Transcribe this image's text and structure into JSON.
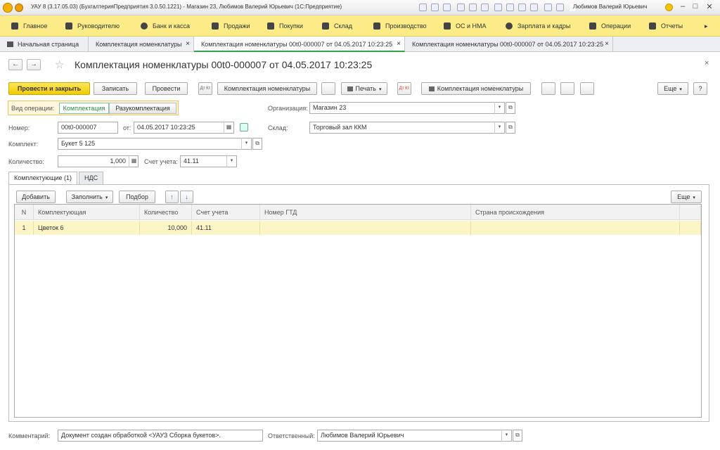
{
  "window": {
    "title": "УАУ 8 (3.17.05.03) (БухгалтерияПредприятия 3.0.50.1221) - Магазин 23, Любимов Валерий Юрьевич  (1С:Предприятие)",
    "user": "Любимов Валерий Юрьевич",
    "ctrl_min": "–",
    "ctrl_max": "□",
    "ctrl_close": "✕"
  },
  "menu": {
    "items": [
      "Главное",
      "Руководителю",
      "Банк и касса",
      "Продажи",
      "Покупки",
      "Склад",
      "Производство",
      "ОС и НМА",
      "Зарплата и кадры",
      "Операции",
      "Отчеты"
    ],
    "more": "▸"
  },
  "tabs": {
    "home": "Начальная страница",
    "t1": "Комплектация номенклатуры",
    "t2": "Комплектация номенклатуры 00t0-000007 от 04.05.2017 10:23:25",
    "t3": "Комплектация номенклатуры 00t0-000007 от 04.05.2017 10:23:25",
    "close": "×"
  },
  "form": {
    "title": "Комплектация номенклатуры 00t0-000007 от 04.05.2017 10:23:25",
    "back": "←",
    "forward": "→",
    "star": "☆",
    "close": "×",
    "toolbar": {
      "post_close": "Провести и закрыть",
      "save": "Записать",
      "post": "Провести",
      "dtkt": "Дт Кт",
      "kit_report": "Комплектация номенклатуры",
      "print": "Печать",
      "kit_print": "Комплектация номенклатуры",
      "more": "Еще",
      "help": "?",
      "caret": "▾"
    },
    "op_label": "Вид операции:",
    "op_assembly": "Комплектация",
    "op_disassembly": "Разукомплектация",
    "org_label": "Организация:",
    "org_value": "Магазин 23",
    "number_label": "Номер:",
    "number_value": "00t0-000007",
    "date_label": "от:",
    "date_value": "04.05.2017 10:23:25",
    "warehouse_label": "Склад:",
    "warehouse_value": "Торговый зал ККМ",
    "kit_label": "Комплект:",
    "kit_value": "Букет 5 125",
    "qty_label": "Количество:",
    "qty_value": "1,000",
    "account_label": "Счет учета:",
    "account_value": "41.11",
    "inner_tabs": {
      "components": "Комплектующие (1)",
      "vat": "НДС"
    },
    "table_toolbar": {
      "add": "Добавить",
      "fill": "Заполнить",
      "select": "Подбор",
      "up": "↑",
      "down": "↓",
      "more": "Еще"
    },
    "table": {
      "headers": [
        "N",
        "Комплектующая",
        "Количество",
        "Счет учета",
        "Номер ГТД",
        "Страна происхождения"
      ],
      "rows": [
        [
          "1",
          "Цветок 6",
          "10,000",
          "41.11",
          "",
          ""
        ]
      ]
    },
    "comment_label": "Комментарий:",
    "comment_value": "Документ создан обработкой <УАУЗ Сборка букетов>.",
    "responsible_label": "Ответственный:",
    "responsible_value": "Любимов Валерий Юрьевич",
    "open_glyph": "⧉",
    "dd_glyph": "▾"
  }
}
